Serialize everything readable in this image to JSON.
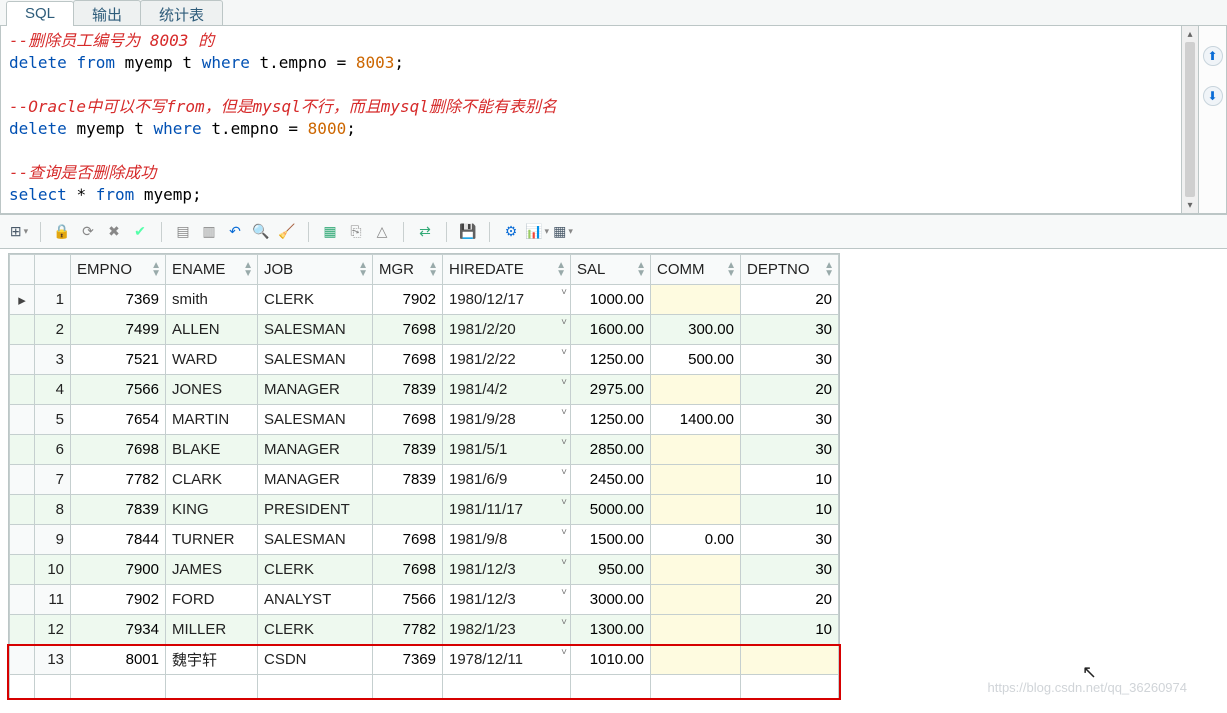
{
  "tabs": {
    "sql": "SQL",
    "output": "输出",
    "stats": "统计表"
  },
  "sql": {
    "cmt1": "--删除员工编号为 8003 的",
    "line1a": "delete",
    "line1b": "from",
    "line1c": "myemp t",
    "line1d": "where",
    "line1e": "t.empno =",
    "line1f": "8003",
    "line1g": ";",
    "cmt2": "--Oracle中可以不写from，但是mysql不行，而且mysql删除不能有表别名",
    "line2a": "delete",
    "line2b": "myemp t",
    "line2c": "where",
    "line2d": "t.empno =",
    "line2e": "8000",
    "line2f": ";",
    "cmt3": "--查询是否删除成功",
    "line3a": "select",
    "line3b": "*",
    "line3c": "from",
    "line3d": "myemp;",
    "blank": ""
  },
  "toolbar": {},
  "grid": {
    "headers": {
      "empno": "EMPNO",
      "ename": "ENAME",
      "job": "JOB",
      "mgr": "MGR",
      "hiredate": "HIREDATE",
      "sal": "SAL",
      "comm": "COMM",
      "deptno": "DEPTNO"
    },
    "rowlabels": [
      "1",
      "2",
      "3",
      "4",
      "5",
      "6",
      "7",
      "8",
      "9",
      "10",
      "11",
      "12",
      "13"
    ],
    "rows": [
      {
        "empno": "7369",
        "ename": "smith",
        "job": "CLERK",
        "mgr": "7902",
        "hiredate": "1980/12/17",
        "sal": "1000.00",
        "comm": "",
        "deptno": "20"
      },
      {
        "empno": "7499",
        "ename": "ALLEN",
        "job": "SALESMAN",
        "mgr": "7698",
        "hiredate": "1981/2/20",
        "sal": "1600.00",
        "comm": "300.00",
        "deptno": "30"
      },
      {
        "empno": "7521",
        "ename": "WARD",
        "job": "SALESMAN",
        "mgr": "7698",
        "hiredate": "1981/2/22",
        "sal": "1250.00",
        "comm": "500.00",
        "deptno": "30"
      },
      {
        "empno": "7566",
        "ename": "JONES",
        "job": "MANAGER",
        "mgr": "7839",
        "hiredate": "1981/4/2",
        "sal": "2975.00",
        "comm": "",
        "deptno": "20"
      },
      {
        "empno": "7654",
        "ename": "MARTIN",
        "job": "SALESMAN",
        "mgr": "7698",
        "hiredate": "1981/9/28",
        "sal": "1250.00",
        "comm": "1400.00",
        "deptno": "30"
      },
      {
        "empno": "7698",
        "ename": "BLAKE",
        "job": "MANAGER",
        "mgr": "7839",
        "hiredate": "1981/5/1",
        "sal": "2850.00",
        "comm": "",
        "deptno": "30"
      },
      {
        "empno": "7782",
        "ename": "CLARK",
        "job": "MANAGER",
        "mgr": "7839",
        "hiredate": "1981/6/9",
        "sal": "2450.00",
        "comm": "",
        "deptno": "10"
      },
      {
        "empno": "7839",
        "ename": "KING",
        "job": "PRESIDENT",
        "mgr": "",
        "hiredate": "1981/11/17",
        "sal": "5000.00",
        "comm": "",
        "deptno": "10"
      },
      {
        "empno": "7844",
        "ename": "TURNER",
        "job": "SALESMAN",
        "mgr": "7698",
        "hiredate": "1981/9/8",
        "sal": "1500.00",
        "comm": "0.00",
        "deptno": "30"
      },
      {
        "empno": "7900",
        "ename": "JAMES",
        "job": "CLERK",
        "mgr": "7698",
        "hiredate": "1981/12/3",
        "sal": "950.00",
        "comm": "",
        "deptno": "30"
      },
      {
        "empno": "7902",
        "ename": "FORD",
        "job": "ANALYST",
        "mgr": "7566",
        "hiredate": "1981/12/3",
        "sal": "3000.00",
        "comm": "",
        "deptno": "20"
      },
      {
        "empno": "7934",
        "ename": "MILLER",
        "job": "CLERK",
        "mgr": "7782",
        "hiredate": "1982/1/23",
        "sal": "1300.00",
        "comm": "",
        "deptno": "10"
      },
      {
        "empno": "8001",
        "ename": "魏宇轩",
        "job": "CSDN",
        "mgr": "7369",
        "hiredate": "1978/12/11",
        "sal": "1010.00",
        "comm": "",
        "deptno": ""
      }
    ]
  },
  "watermark": "https://blog.csdn.net/qq_36260974"
}
